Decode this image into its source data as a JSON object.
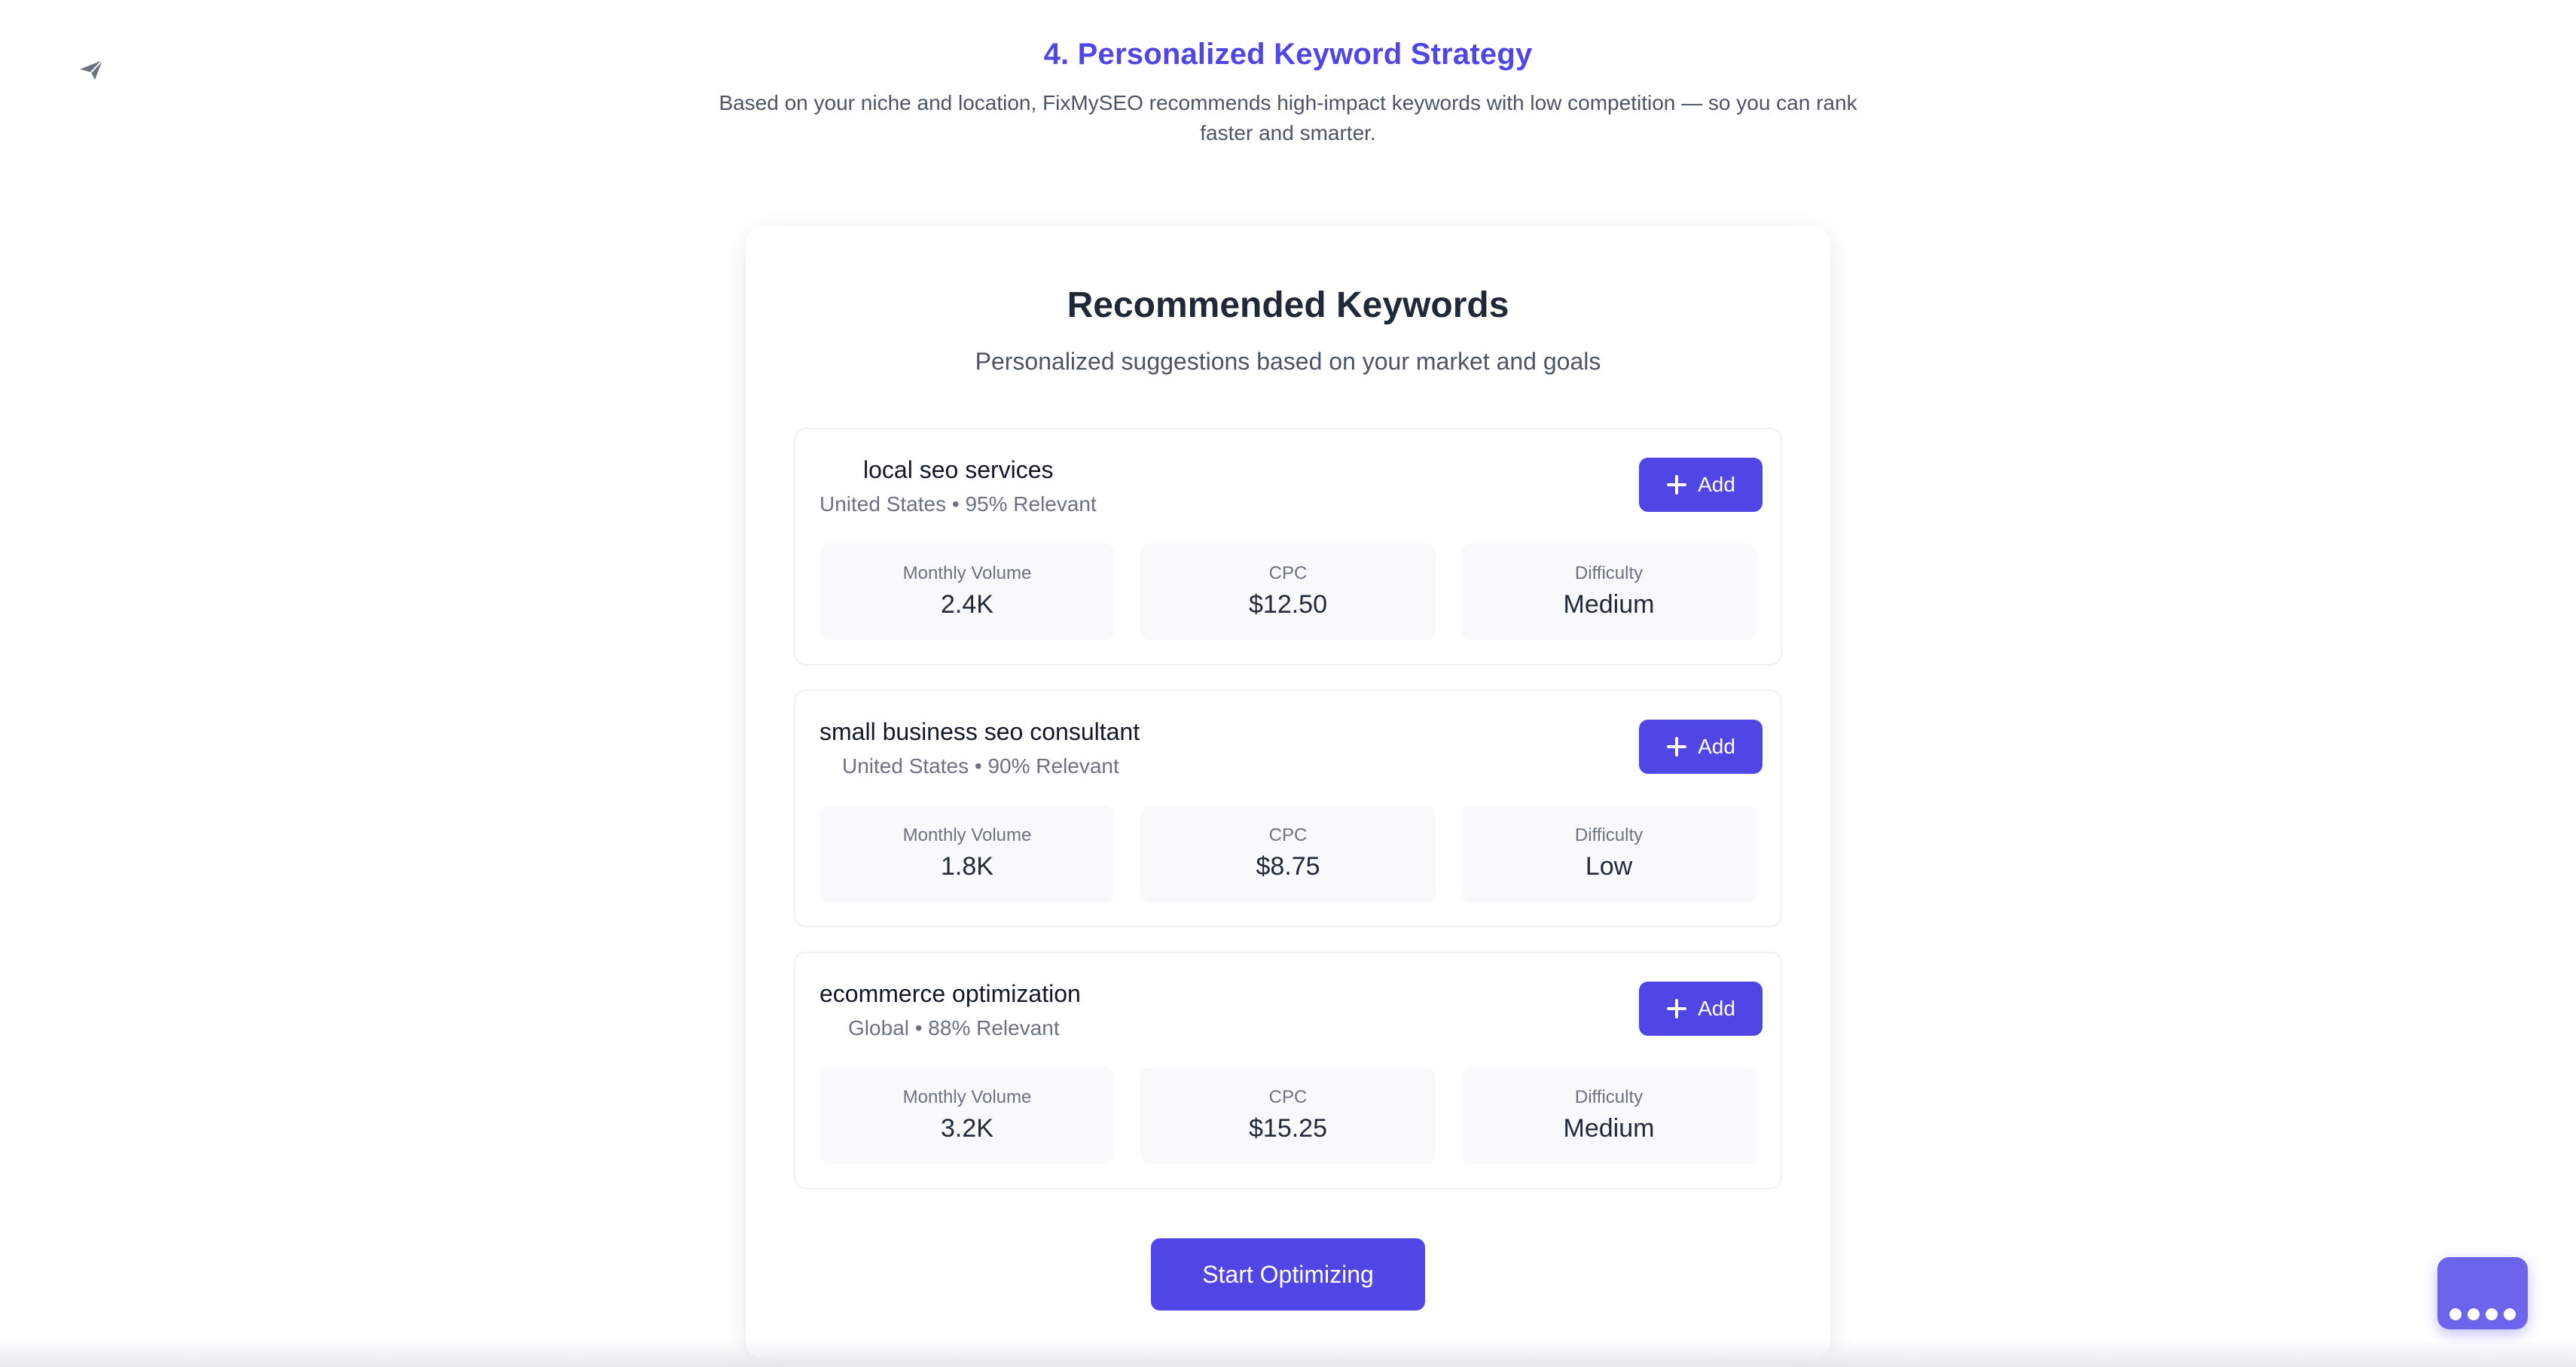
{
  "section": {
    "title": "4. Personalized Keyword Strategy",
    "description": "Based on your niche and location, FixMySEO recommends high-impact keywords with low competition — so you can rank faster and smarter."
  },
  "panel": {
    "title": "Recommended Keywords",
    "subtitle": "Personalized suggestions based on your market and goals",
    "cta_label": "Start Optimizing"
  },
  "metric_labels": {
    "volume": "Monthly Volume",
    "cpc": "CPC",
    "difficulty": "Difficulty"
  },
  "keywords": [
    {
      "name": "local seo services",
      "meta": "United States • 95% Relevant",
      "add_label": "Add",
      "volume": "2.4K",
      "cpc": "$12.50",
      "difficulty": "Medium"
    },
    {
      "name": "small business seo consultant",
      "meta": "United States • 90% Relevant",
      "add_label": "Add",
      "volume": "1.8K",
      "cpc": "$8.75",
      "difficulty": "Low"
    },
    {
      "name": "ecommerce optimization",
      "meta": "Global • 88% Relevant",
      "add_label": "Add",
      "volume": "3.2K",
      "cpc": "$15.25",
      "difficulty": "Medium"
    }
  ],
  "colors": {
    "accent": "#4f46e5",
    "chat_widget": "#6d64ec"
  },
  "icons": {
    "top_left": "send-icon",
    "add": "plus-icon",
    "chat": "chat-dots-icon"
  }
}
